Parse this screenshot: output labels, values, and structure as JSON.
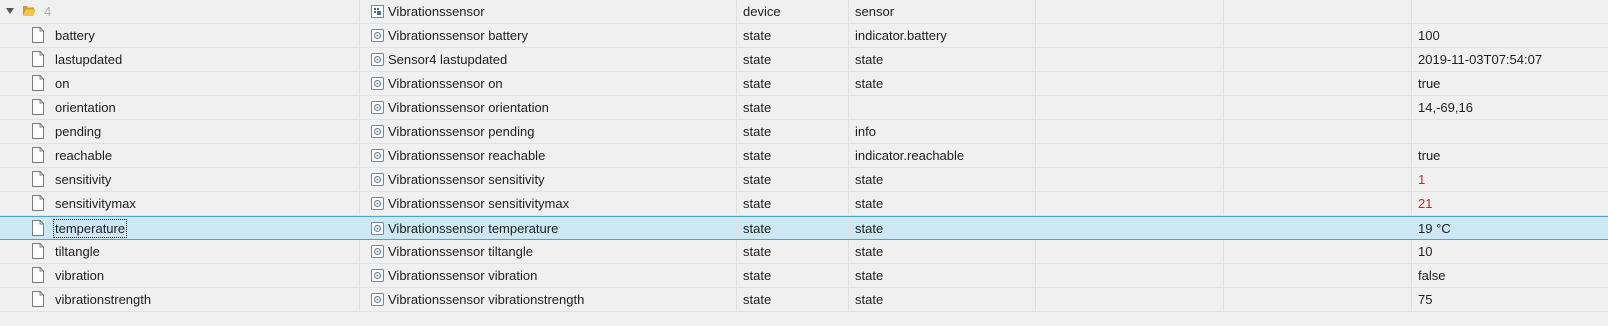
{
  "parent": {
    "id": "4",
    "name": "Vibrationssensor",
    "type": "device",
    "role": "sensor"
  },
  "rows": [
    {
      "id": "battery",
      "name": "Vibrationssensor battery",
      "type": "state",
      "role": "indicator.battery",
      "value": "100"
    },
    {
      "id": "lastupdated",
      "name": "Sensor4 lastupdated",
      "type": "state",
      "role": "state",
      "value": "2019-11-03T07:54:07"
    },
    {
      "id": "on",
      "name": "Vibrationssensor on",
      "type": "state",
      "role": "state",
      "value": "true"
    },
    {
      "id": "orientation",
      "name": "Vibrationssensor orientation",
      "type": "state",
      "role": "",
      "value": "14,-69,16"
    },
    {
      "id": "pending",
      "name": "Vibrationssensor pending",
      "type": "state",
      "role": "info",
      "value": ""
    },
    {
      "id": "reachable",
      "name": "Vibrationssensor reachable",
      "type": "state",
      "role": "indicator.reachable",
      "value": "true"
    },
    {
      "id": "sensitivity",
      "name": "Vibrationssensor sensitivity",
      "type": "state",
      "role": "state",
      "value": "1",
      "value_color": "#c62828"
    },
    {
      "id": "sensitivitymax",
      "name": "Vibrationssensor sensitivitymax",
      "type": "state",
      "role": "state",
      "value": "21",
      "value_color": "#c62828"
    },
    {
      "id": "temperature",
      "name": "Vibrationssensor temperature",
      "type": "state",
      "role": "state",
      "value": "19 °C",
      "selected": true
    },
    {
      "id": "tiltangle",
      "name": "Vibrationssensor tiltangle",
      "type": "state",
      "role": "state",
      "value": "10"
    },
    {
      "id": "vibration",
      "name": "Vibrationssensor vibration",
      "type": "state",
      "role": "state",
      "value": "false"
    },
    {
      "id": "vibrationstrength",
      "name": "Vibrationssensor vibrationstrength",
      "type": "state",
      "role": "state",
      "value": "75"
    }
  ],
  "colors": {
    "selected_bg": "#cce8f5",
    "selected_border": "#4fa3cf",
    "value_alert": "#c62828",
    "folder": "#e8b53a"
  }
}
